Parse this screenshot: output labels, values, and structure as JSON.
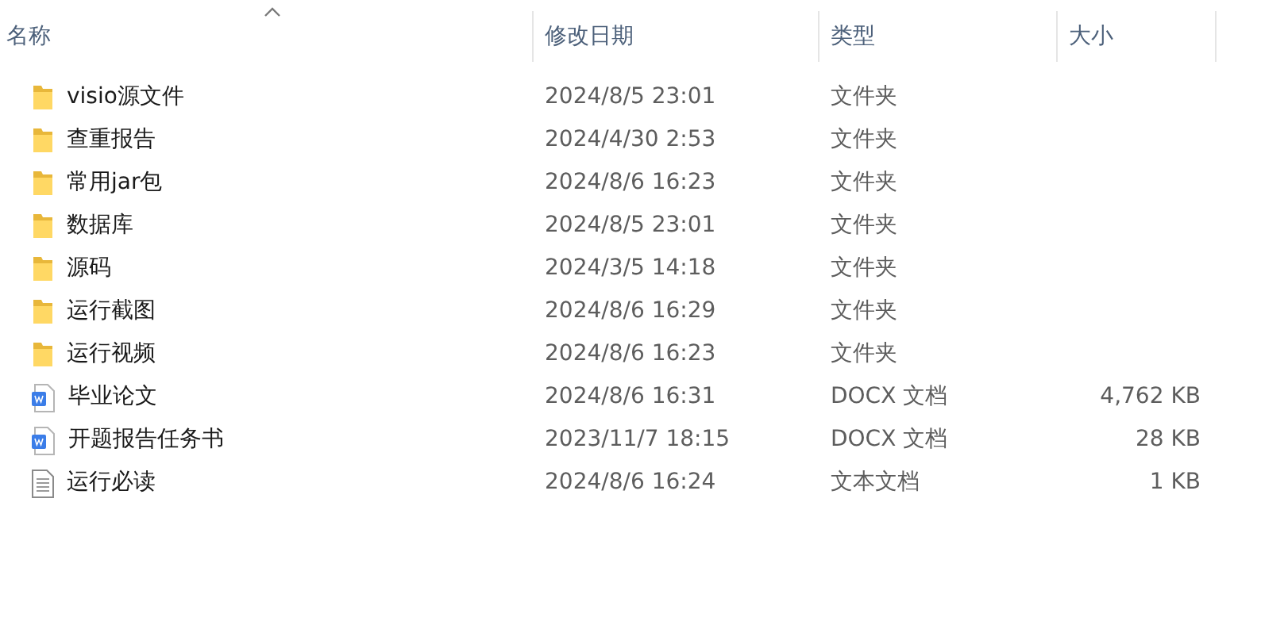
{
  "columns": [
    {
      "label": "名称",
      "sorted": true
    },
    {
      "label": "修改日期",
      "sorted": false
    },
    {
      "label": "类型",
      "sorted": false
    },
    {
      "label": "大小",
      "sorted": false
    }
  ],
  "files": [
    {
      "kind": "folder",
      "name": "visio源文件",
      "modified": "2024/8/5 23:01",
      "type": "文件夹"
    },
    {
      "kind": "folder",
      "name": "查重报告",
      "modified": "2024/4/30 2:53",
      "type": "文件夹"
    },
    {
      "kind": "folder",
      "name": "常用jar包",
      "modified": "2024/8/6 16:23",
      "type": "文件夹"
    },
    {
      "kind": "folder",
      "name": "数据库",
      "modified": "2024/8/5 23:01",
      "type": "文件夹"
    },
    {
      "kind": "folder",
      "name": "源码",
      "modified": "2024/3/5 14:18",
      "type": "文件夹"
    },
    {
      "kind": "folder",
      "name": "运行截图",
      "modified": "2024/8/6 16:29",
      "type": "文件夹"
    },
    {
      "kind": "folder",
      "name": "运行视频",
      "modified": "2024/8/6 16:23",
      "type": "文件夹"
    },
    {
      "kind": "docx",
      "name": "毕业论文",
      "modified": "2024/8/6 16:31",
      "type": "DOCX 文档",
      "size": "4,762 KB"
    },
    {
      "kind": "docx",
      "name": "开题报告任务书",
      "modified": "2023/11/7 18:15",
      "type": "DOCX 文档",
      "size": "28 KB"
    },
    {
      "kind": "text",
      "name": "运行必读",
      "modified": "2024/8/6 16:24",
      "type": "文本文档",
      "size": "1 KB"
    }
  ]
}
